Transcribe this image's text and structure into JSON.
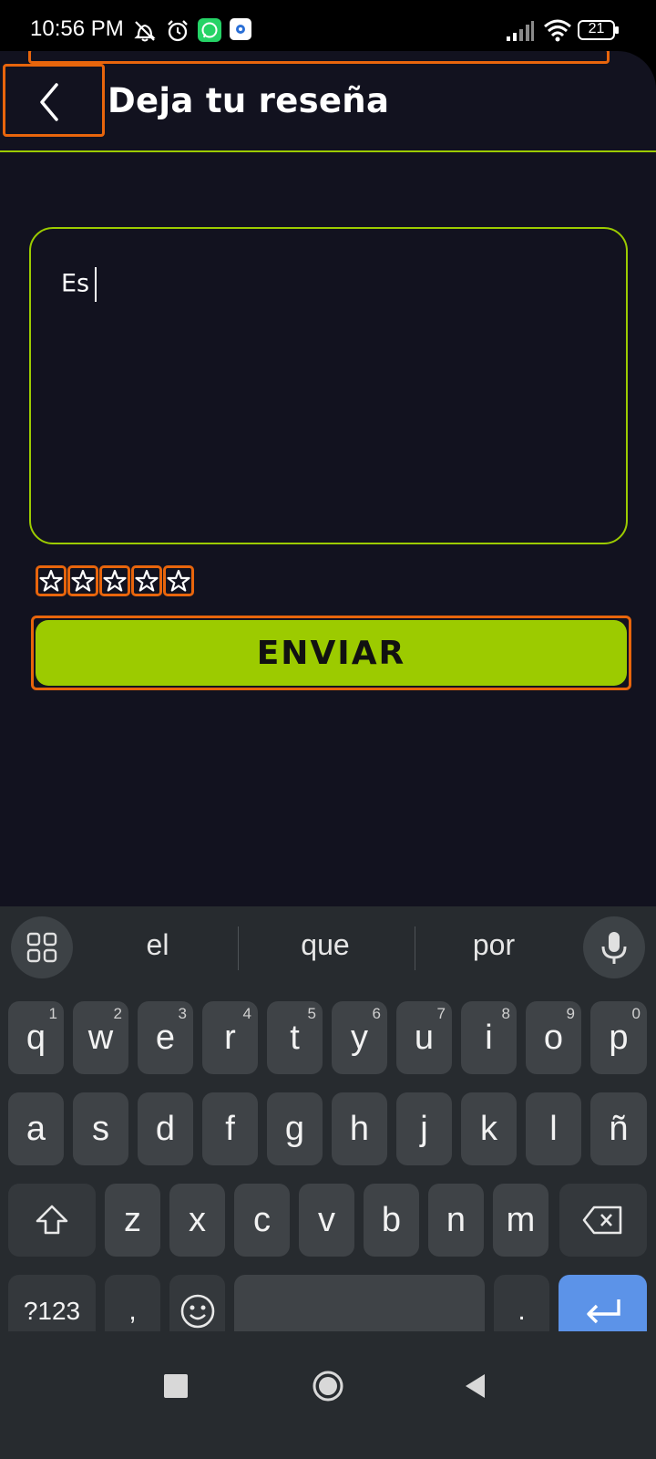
{
  "status_bar": {
    "time": "10:56 PM",
    "battery": "21",
    "icons": [
      "mute-bell-icon",
      "alarm-icon",
      "whatsapp-icon",
      "app-notification-icon",
      "signal-icon",
      "wifi-icon",
      "battery-icon"
    ]
  },
  "header": {
    "title": "Deja tu reseña",
    "back_icon": "chevron-left-icon"
  },
  "review": {
    "text": "Es"
  },
  "rating": {
    "max": 5,
    "value": 0
  },
  "send_button": {
    "label": "ENVIAR"
  },
  "keyboard": {
    "suggestions": [
      "el",
      "que",
      "por"
    ],
    "row1": [
      {
        "k": "q",
        "h": "1"
      },
      {
        "k": "w",
        "h": "2"
      },
      {
        "k": "e",
        "h": "3"
      },
      {
        "k": "r",
        "h": "4"
      },
      {
        "k": "t",
        "h": "5"
      },
      {
        "k": "y",
        "h": "6"
      },
      {
        "k": "u",
        "h": "7"
      },
      {
        "k": "i",
        "h": "8"
      },
      {
        "k": "o",
        "h": "9"
      },
      {
        "k": "p",
        "h": "0"
      }
    ],
    "row2": [
      "a",
      "s",
      "d",
      "f",
      "g",
      "h",
      "j",
      "k",
      "l",
      "ñ"
    ],
    "row3": [
      "z",
      "x",
      "c",
      "v",
      "b",
      "n",
      "m"
    ],
    "symbols_label": "?123",
    "comma": ",",
    "period": "."
  },
  "colors": {
    "accent": "#9ccb00",
    "background": "#12121f",
    "highlight": "#e8650c",
    "enter_key": "#5c93e8"
  }
}
